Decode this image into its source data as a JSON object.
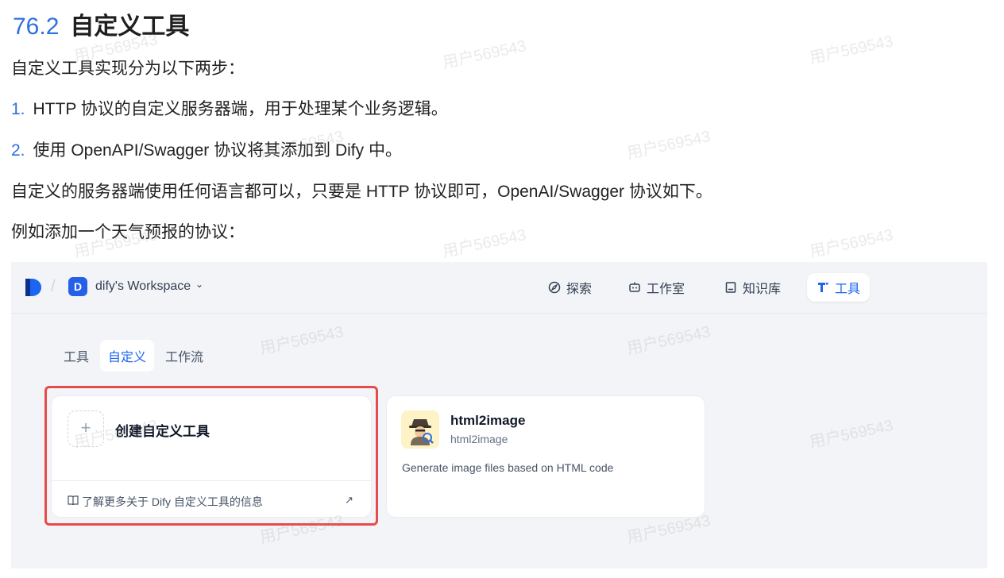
{
  "heading": {
    "number": "76.2",
    "title": "自定义工具"
  },
  "intro": "自定义工具实现分为以下两步：",
  "steps": [
    {
      "index": "1.",
      "text": "HTTP 协议的自定义服务器端，用于处理某个业务逻辑。"
    },
    {
      "index": "2.",
      "text": "使用 OpenAPI/Swagger 协议将其添加到 Dify 中。"
    }
  ],
  "para_protocol": "自定义的服务器端使用任何语言都可以，只要是 HTTP 协议即可，OpenAI/Swagger 协议如下。",
  "para_example": "例如添加一个天气预报的协议：",
  "watermark": "用户569543",
  "screenshot": {
    "workspace": {
      "badge": "D",
      "name": "dify's Workspace",
      "chevron": "⌄"
    },
    "nav": [
      {
        "label": "探索",
        "icon": "compass-icon",
        "active": false
      },
      {
        "label": "工作室",
        "icon": "robot-icon",
        "active": false
      },
      {
        "label": "知识库",
        "icon": "book-icon",
        "active": false
      },
      {
        "label": "工具",
        "icon": "tools-icon",
        "active": true
      }
    ],
    "tabs": [
      {
        "label": "工具",
        "active": false
      },
      {
        "label": "自定义",
        "active": true
      },
      {
        "label": "工作流",
        "active": false
      }
    ],
    "create_card": {
      "plus": "+",
      "title": "创建自定义工具",
      "footer_link": "了解更多关于 Dify 自定义工具的信息",
      "arrow": "↗"
    },
    "tool_card": {
      "name": "html2image",
      "subtitle": "html2image",
      "description": "Generate image files based on HTML code",
      "avatar_icon": "detective-icon"
    },
    "colors": {
      "accent": "#1c64f2",
      "highlight": "#e84b4b",
      "avatar_bg": "#fdf3c6",
      "bg": "#f2f4f7"
    }
  }
}
